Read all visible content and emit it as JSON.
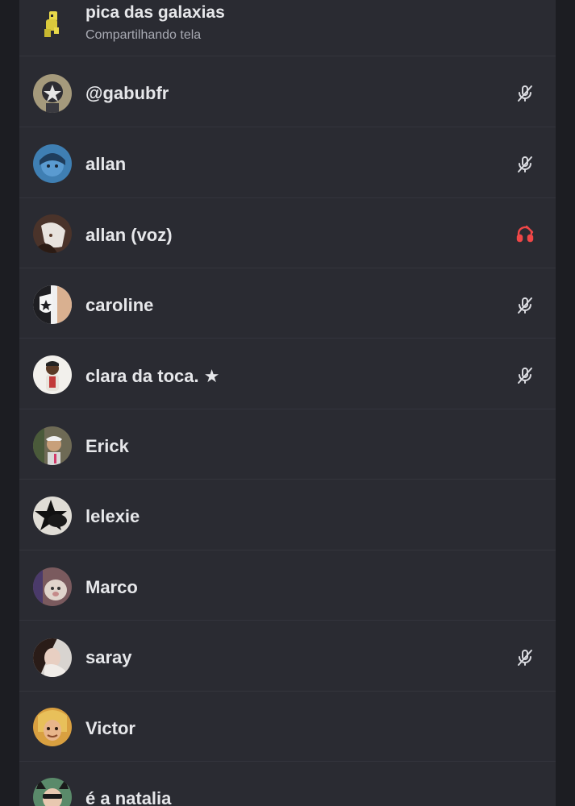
{
  "colors": {
    "background": "#1c1d22",
    "panel": "#2a2b32",
    "divider": "#34353d",
    "text": "#e6e7ea",
    "subtext": "#a8aab3",
    "muted_icon": "#d9dadf",
    "deafened_icon": "#f04747"
  },
  "header_member": {
    "name": "pica das galaxias",
    "subtitle": "Compartilhando tela",
    "avatar_icon": "yellow-character-avatar"
  },
  "members": [
    {
      "name": "@gabubfr",
      "status_icon": "muted-microphone-icon"
    },
    {
      "name": "allan",
      "status_icon": "muted-microphone-icon"
    },
    {
      "name": "allan (voz)",
      "status_icon": "deafened-headphones-icon"
    },
    {
      "name": "caroline",
      "status_icon": "muted-microphone-icon"
    },
    {
      "name": "clara da toca. ★",
      "status_icon": "muted-microphone-icon"
    },
    {
      "name": "Erick",
      "status_icon": ""
    },
    {
      "name": "lelexie",
      "status_icon": ""
    },
    {
      "name": "Marco",
      "status_icon": ""
    },
    {
      "name": "saray",
      "status_icon": "muted-microphone-icon"
    },
    {
      "name": "Victor",
      "status_icon": ""
    },
    {
      "name": "é a natalia",
      "status_icon": ""
    }
  ]
}
